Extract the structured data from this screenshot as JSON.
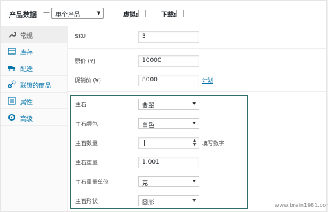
{
  "header": {
    "title": "产品数据",
    "separator": "—",
    "product_type": "单个产品",
    "virtual_label": "虚拟:",
    "download_label": "下载:"
  },
  "sidebar": {
    "items": [
      {
        "label": "常规",
        "icon": "wrench-icon",
        "active": true
      },
      {
        "label": "库存",
        "icon": "inventory-icon",
        "active": false
      },
      {
        "label": "配送",
        "icon": "truck-icon",
        "active": false
      },
      {
        "label": "联锁的商品",
        "icon": "link-icon",
        "active": false
      },
      {
        "label": "属性",
        "icon": "list-icon",
        "active": false
      },
      {
        "label": "高级",
        "icon": "gear-icon",
        "active": false
      }
    ]
  },
  "general": {
    "sku_label": "SKU",
    "sku_value": "3",
    "price_label": "原价 (¥)",
    "price_value": "10000",
    "sale_label": "促销价 (¥)",
    "sale_value": "8000",
    "schedule_link": "计划"
  },
  "attributes": [
    {
      "label": "主石",
      "value": "翡翠",
      "kind": "select"
    },
    {
      "label": "主石颜色",
      "value": "白色",
      "kind": "select"
    },
    {
      "label": "主石数量",
      "value": "",
      "kind": "number",
      "hint": "填写数字"
    },
    {
      "label": "主石重量",
      "value": "1.001",
      "kind": "text"
    },
    {
      "label": "主石重量单位",
      "value": "克",
      "kind": "select"
    },
    {
      "label": "主石形状",
      "value": "圆形",
      "kind": "select"
    }
  ],
  "watermark": "www.brain1981.com",
  "colors": {
    "accent": "#0073aa",
    "highlight_border": "#2e6f6a"
  }
}
